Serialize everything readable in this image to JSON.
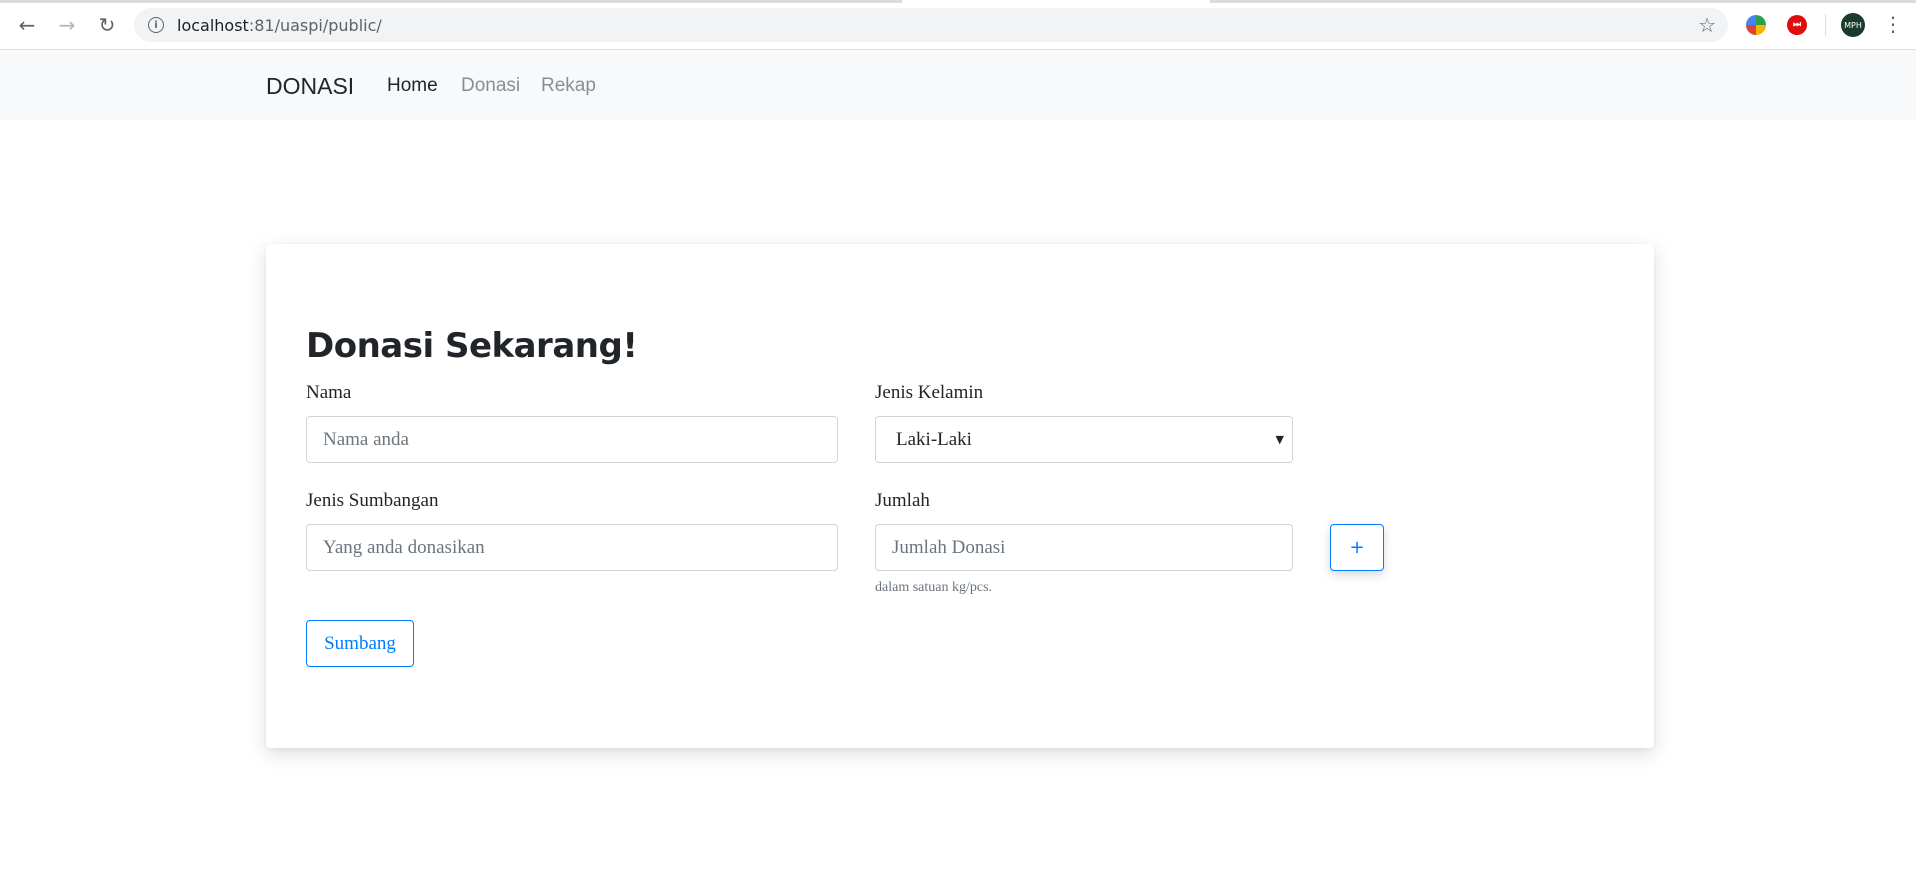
{
  "browser": {
    "url_host": "localhost",
    "url_path": ":81/uaspi/public/",
    "profile_initials": "MPH",
    "ext_red_glyph": "⏭"
  },
  "navbar": {
    "brand": "DONASI",
    "links": [
      {
        "label": "Home",
        "active": true
      },
      {
        "label": "Donasi",
        "active": false
      },
      {
        "label": "Rekap",
        "active": false
      }
    ]
  },
  "form": {
    "title": "Donasi Sekarang!",
    "nama": {
      "label": "Nama",
      "placeholder": "Nama anda"
    },
    "jenis_kelamin": {
      "label": "Jenis Kelamin",
      "selected": "Laki-Laki"
    },
    "jenis_sumbangan": {
      "label": "Jenis Sumbangan",
      "placeholder": "Yang anda donasikan"
    },
    "jumlah": {
      "label": "Jumlah",
      "placeholder": "Jumlah Donasi",
      "help": "dalam satuan kg/pcs."
    },
    "add_label": "+",
    "submit_label": "Sumbang"
  },
  "colors": {
    "primary": "#007bff",
    "navbar_bg": "#f8f9fa",
    "text": "#212529",
    "muted": "#6c757d"
  }
}
